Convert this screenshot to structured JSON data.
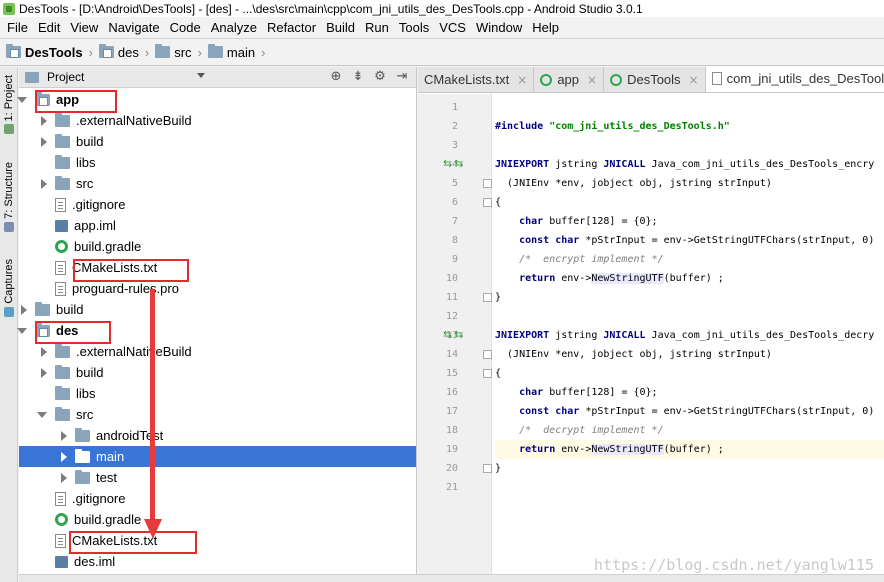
{
  "window": {
    "title": "DesTools - [D:\\Android\\DesTools] - [des] - ...\\des\\src\\main\\cpp\\com_jni_utils_des_DesTools.cpp - Android Studio 3.0.1"
  },
  "menu": [
    "File",
    "Edit",
    "View",
    "Navigate",
    "Code",
    "Analyze",
    "Refactor",
    "Build",
    "Run",
    "Tools",
    "VCS",
    "Window",
    "Help"
  ],
  "breadcrumb": [
    "DesTools",
    "des",
    "src",
    "main"
  ],
  "tool_stripe": {
    "project": "1: Project",
    "structure": "7: Structure",
    "captures": "Captures"
  },
  "project_panel": {
    "title": "Project",
    "tools": [
      "target-icon",
      "collapse-icon",
      "gear-icon",
      "hide-icon"
    ],
    "tree": [
      {
        "label": "app",
        "kind": "module",
        "arrow": "down",
        "depth": 0,
        "bold": true
      },
      {
        "label": ".externalNativeBuild",
        "kind": "folder",
        "arrow": "right",
        "depth": 1
      },
      {
        "label": "build",
        "kind": "folder",
        "arrow": "right",
        "depth": 1
      },
      {
        "label": "libs",
        "kind": "folder",
        "arrow": "none",
        "depth": 1
      },
      {
        "label": "src",
        "kind": "folder",
        "arrow": "right",
        "depth": 1
      },
      {
        "label": ".gitignore",
        "kind": "file",
        "arrow": "none",
        "depth": 1
      },
      {
        "label": "app.iml",
        "kind": "iml",
        "arrow": "none",
        "depth": 1
      },
      {
        "label": "build.gradle",
        "kind": "gradle",
        "arrow": "none",
        "depth": 1
      },
      {
        "label": "CMakeLists.txt",
        "kind": "file",
        "arrow": "none",
        "depth": 1
      },
      {
        "label": "proguard-rules.pro",
        "kind": "file",
        "arrow": "none",
        "depth": 1
      },
      {
        "label": "build",
        "kind": "folder",
        "arrow": "right",
        "depth": 0
      },
      {
        "label": "des",
        "kind": "module",
        "arrow": "down",
        "depth": 0,
        "bold": true
      },
      {
        "label": ".externalNativeBuild",
        "kind": "folder",
        "arrow": "right",
        "depth": 1
      },
      {
        "label": "build",
        "kind": "folder",
        "arrow": "right",
        "depth": 1
      },
      {
        "label": "libs",
        "kind": "folder",
        "arrow": "none",
        "depth": 1
      },
      {
        "label": "src",
        "kind": "folder",
        "arrow": "down",
        "depth": 1
      },
      {
        "label": "androidTest",
        "kind": "folder",
        "arrow": "right",
        "depth": 2
      },
      {
        "label": "main",
        "kind": "folder",
        "arrow": "right",
        "depth": 2,
        "selected": true
      },
      {
        "label": "test",
        "kind": "folder",
        "arrow": "right",
        "depth": 2
      },
      {
        "label": ".gitignore",
        "kind": "file",
        "arrow": "none",
        "depth": 1
      },
      {
        "label": "build.gradle",
        "kind": "gradle",
        "arrow": "none",
        "depth": 1
      },
      {
        "label": "CMakeLists.txt",
        "kind": "file",
        "arrow": "none",
        "depth": 1
      },
      {
        "label": "des.iml",
        "kind": "iml",
        "arrow": "none",
        "depth": 1
      }
    ]
  },
  "editor": {
    "tabs": [
      {
        "label": "CMakeLists.txt",
        "icon": "file-icon",
        "active": false
      },
      {
        "label": "app",
        "icon": "gradle-icon",
        "active": false
      },
      {
        "label": "DesTools",
        "icon": "gradle-icon",
        "active": false
      },
      {
        "label": "com_jni_utils_des_DesTools",
        "icon": "cpp-file-icon",
        "active": true
      }
    ],
    "lines": [
      {
        "n": "1",
        "code": ""
      },
      {
        "n": "2",
        "code": "#include \"com_jni_utils_des_DesTools.h\""
      },
      {
        "n": "3",
        "code": ""
      },
      {
        "n": "4",
        "code": "JNIEXPORT jstring JNICALL Java_com_jni_utils_des_DesTools_encry"
      },
      {
        "n": "5",
        "code": "  (JNIEnv *env, jobject obj, jstring strInput)"
      },
      {
        "n": "6",
        "code": "{"
      },
      {
        "n": "7",
        "code": "    char buffer[128] = {0};"
      },
      {
        "n": "8",
        "code": "    const char *pStrInput = env->GetStringUTFChars(strInput, 0)"
      },
      {
        "n": "9",
        "code": "    /*  encrypt implement */"
      },
      {
        "n": "10",
        "code": "    return env->NewStringUTF(buffer) ;"
      },
      {
        "n": "11",
        "code": "}"
      },
      {
        "n": "12",
        "code": ""
      },
      {
        "n": "13",
        "code": "JNIEXPORT jstring JNICALL Java_com_jni_utils_des_DesTools_decry"
      },
      {
        "n": "14",
        "code": "  (JNIEnv *env, jobject obj, jstring strInput)"
      },
      {
        "n": "15",
        "code": "{"
      },
      {
        "n": "16",
        "code": "    char buffer[128] = {0};"
      },
      {
        "n": "17",
        "code": "    const char *pStrInput = env->GetStringUTFChars(strInput, 0)"
      },
      {
        "n": "18",
        "code": "    /*  decrypt implement */"
      },
      {
        "n": "19",
        "code": "    return env->NewStringUTF(buffer) ;"
      },
      {
        "n": "20",
        "code": "}"
      },
      {
        "n": "21",
        "code": ""
      }
    ],
    "watermark": "https://blog.csdn.net/yanglw115"
  },
  "colors": {
    "selection": "#3875d7",
    "annotation_red": "#e32b2b",
    "keyword": "#000080",
    "string": "#008000",
    "comment": "#808080"
  }
}
